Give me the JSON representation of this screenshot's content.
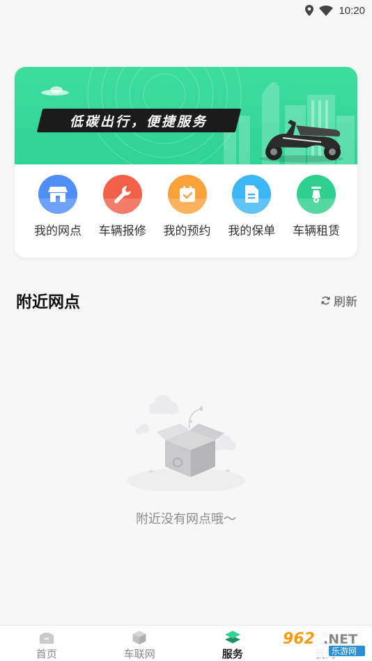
{
  "status_bar": {
    "time": "10:20",
    "icons": [
      "location-icon",
      "wifi-icon"
    ]
  },
  "banner": {
    "slogan": "低碳出行，便捷服务"
  },
  "shortcuts": [
    {
      "label": "我的网点",
      "icon": "store-icon",
      "color": "#4f8ef7"
    },
    {
      "label": "车辆报修",
      "icon": "wrench-icon",
      "color": "#f2604a"
    },
    {
      "label": "我的预约",
      "icon": "calendar-check-icon",
      "color": "#f9a23c"
    },
    {
      "label": "我的保单",
      "icon": "document-icon",
      "color": "#3cb6f5"
    },
    {
      "label": "车辆租赁",
      "icon": "scooter-icon",
      "color": "#2fcf8d"
    }
  ],
  "nearby": {
    "title": "附近网点",
    "refresh_label": "刷新",
    "empty_text": "附近没有网点哦～"
  },
  "tabs": [
    {
      "label": "首页",
      "icon": "home-icon",
      "active": false
    },
    {
      "label": "车联网",
      "icon": "cube-icon",
      "active": false
    },
    {
      "label": "服务",
      "icon": "layers-icon",
      "active": true
    },
    {
      "label": "我的",
      "icon": "user-icon",
      "active": false
    }
  ],
  "watermark": {
    "text_top": "962.NET",
    "text_bottom": "乐游网"
  },
  "colors": {
    "accent": "#2fd394",
    "background": "#f7f7f8"
  }
}
